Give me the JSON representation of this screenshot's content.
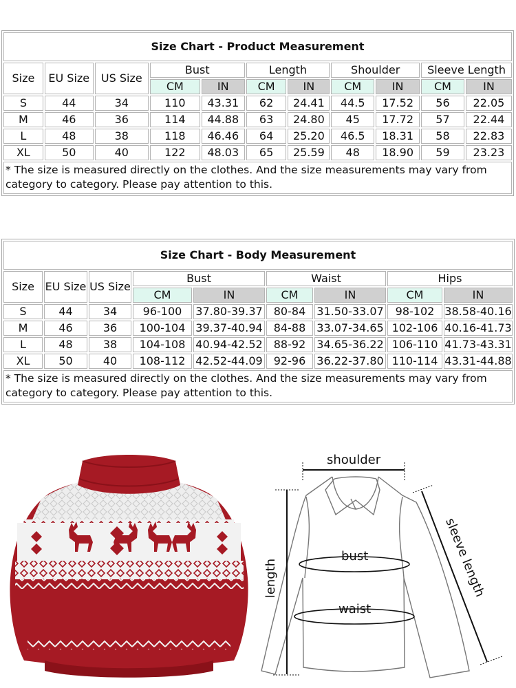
{
  "product_chart": {
    "title": "Size Chart - Product Measurement",
    "headers": {
      "size": "Size",
      "eu_size": "EU Size",
      "us_size": "US Size",
      "groups": [
        "Bust",
        "Length",
        "Shoulder",
        "Sleeve Length"
      ],
      "cm": "CM",
      "in": "IN"
    },
    "rows": [
      [
        "S",
        "44",
        "34",
        "110",
        "43.31",
        "62",
        "24.41",
        "44.5",
        "17.52",
        "56",
        "22.05"
      ],
      [
        "M",
        "46",
        "36",
        "114",
        "44.88",
        "63",
        "24.80",
        "45",
        "17.72",
        "57",
        "22.44"
      ],
      [
        "L",
        "48",
        "38",
        "118",
        "46.46",
        "64",
        "25.20",
        "46.5",
        "18.31",
        "58",
        "22.83"
      ],
      [
        "XL",
        "50",
        "40",
        "122",
        "48.03",
        "65",
        "25.59",
        "48",
        "18.90",
        "59",
        "23.23"
      ]
    ],
    "note": "* The size is measured directly on the clothes. And the size measurements may vary from category to category. Please pay attention to this."
  },
  "body_chart": {
    "title": "Size Chart - Body Measurement",
    "headers": {
      "size": "Size",
      "eu_size": "EU Size",
      "us_size": "US Size",
      "groups": [
        "Bust",
        "Waist",
        "Hips"
      ],
      "cm": "CM",
      "in": "IN"
    },
    "rows": [
      [
        "S",
        "44",
        "34",
        "96-100",
        "37.80-39.37",
        "80-84",
        "31.50-33.07",
        "98-102",
        "38.58-40.16"
      ],
      [
        "M",
        "46",
        "36",
        "100-104",
        "39.37-40.94",
        "84-88",
        "33.07-34.65",
        "102-106",
        "40.16-41.73"
      ],
      [
        "L",
        "48",
        "38",
        "104-108",
        "40.94-42.52",
        "88-92",
        "34.65-36.22",
        "106-110",
        "41.73-43.31"
      ],
      [
        "XL",
        "50",
        "40",
        "108-112",
        "42.52-44.09",
        "92-96",
        "36.22-37.80",
        "110-114",
        "43.31-44.88"
      ]
    ],
    "note": "* The size is measured directly on the clothes. And the size measurements may vary from category to category. Please pay attention to this."
  },
  "product_image": {
    "description": "Red turtleneck Christmas sweater with white reindeer Fair Isle pattern",
    "colors": {
      "main": "#a61a24",
      "pattern": "#f2f2f2",
      "shadow": "#8a1119"
    }
  },
  "diagram": {
    "labels": {
      "shoulder": "shoulder",
      "bust": "bust",
      "waist": "waist",
      "length": "length",
      "sleeve_length": "sleeve length"
    }
  }
}
